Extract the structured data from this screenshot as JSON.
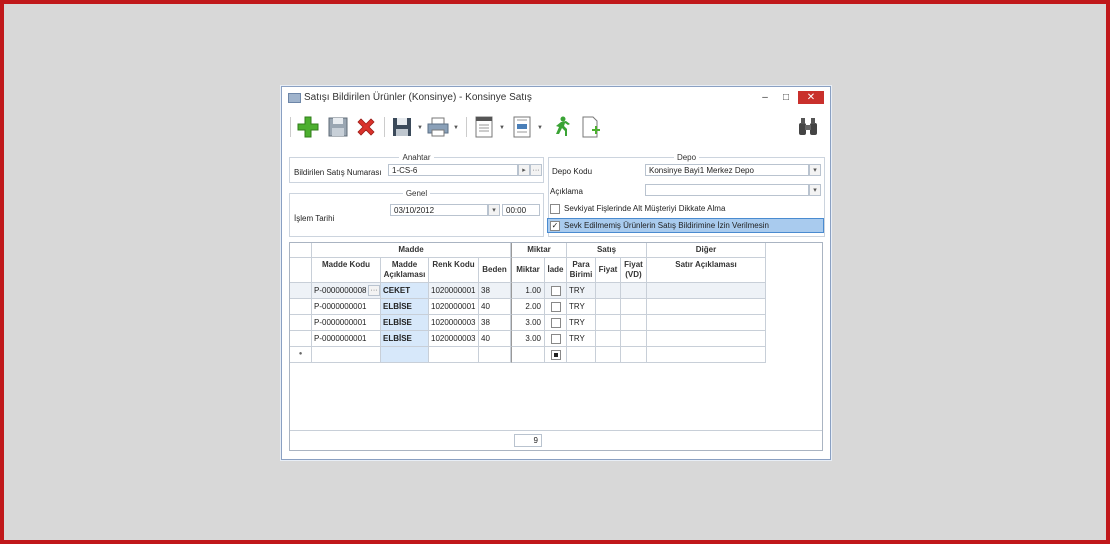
{
  "window": {
    "title": "Satışı Bildirilen Ürünler (Konsinye) - Konsinye Satış"
  },
  "titlebar": {
    "minimize": "–",
    "maximize": "□",
    "close": "✕"
  },
  "toolbar": {
    "icons": [
      "add-icon",
      "save-icon",
      "delete-icon",
      "save-as-icon",
      "print-icon",
      "report-icon",
      "document-icon",
      "run-icon",
      "new-document-icon",
      "binoculars-icon"
    ]
  },
  "anahtar": {
    "legend": "Anahtar",
    "field_label": "Bildirilen Satış Numarası",
    "field_value": "1-CS-6"
  },
  "genel": {
    "legend": "Genel",
    "date_label": "İşlem Tarihi",
    "date_value": "03/10/2012",
    "time_value": "00:00"
  },
  "depo": {
    "legend": "Depo",
    "code_label": "Depo Kodu",
    "code_value": "Konsinye Bayi1 Merkez Depo",
    "desc_label": "Açıklama",
    "desc_value": "",
    "check1_label": "Sevkiyat Fişlerinde Alt Müşteriyi Dikkate Alma",
    "check2_label": "Sevk Edilmemiş Ürünlerin Satış Bildirimine İzin Verilmesin"
  },
  "grid": {
    "groups": {
      "madde": "Madde",
      "miktar": "Miktar",
      "satis": "Satış",
      "diger": "Diğer"
    },
    "columns": {
      "madde_kodu": "Madde Kodu",
      "madde_aciklamasi": "Madde Açıklaması",
      "renk_kodu": "Renk Kodu",
      "beden": "Beden",
      "miktar": "Miktar",
      "iade": "İade",
      "para_birimi": "Para Birimi",
      "fiyat": "Fiyat",
      "fiyat_vd": "Fiyat (VD)",
      "satir_aciklamasi": "Satır Açıklaması"
    },
    "rows": [
      {
        "madde_kodu": "P-0000000008",
        "aciklama": "CEKET",
        "renk": "1020000001",
        "beden": "38",
        "miktar": "1.00",
        "para": "TRY"
      },
      {
        "madde_kodu": "P-0000000001",
        "aciklama": "ELBİSE",
        "renk": "1020000001",
        "beden": "40",
        "miktar": "2.00",
        "para": "TRY"
      },
      {
        "madde_kodu": "P-0000000001",
        "aciklama": "ELBİSE",
        "renk": "1020000003",
        "beden": "38",
        "miktar": "3.00",
        "para": "TRY"
      },
      {
        "madde_kodu": "P-0000000001",
        "aciklama": "ELBİSE",
        "renk": "1020000003",
        "beden": "40",
        "miktar": "3.00",
        "para": "TRY"
      }
    ],
    "total_miktar": "9",
    "new_row_marker": "●"
  }
}
